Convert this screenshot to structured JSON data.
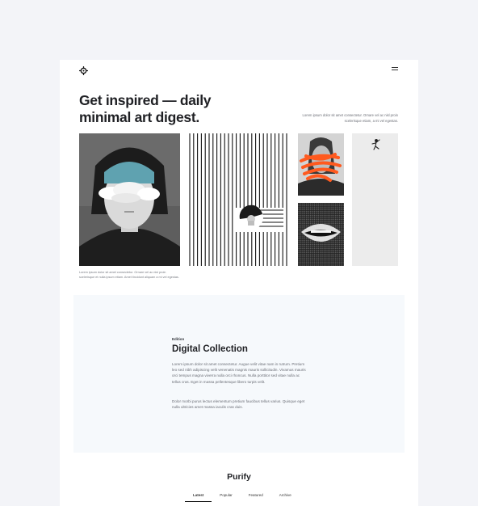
{
  "header": {
    "logo_icon": "crosshair-logo-icon",
    "menu_icon": "hamburger-menu-icon"
  },
  "hero": {
    "headline_line1": "Get inspired — daily",
    "headline_line2": "minimal art digest.",
    "intro_text": "Lorem ipsum dolor sit amet consectetur. Ornare vel ac nisl proin scelerisque etiam, a mi vel egestas.",
    "caption": "Lorem ipsum dolor sit amet consectetur. Ornare vel ac nisl proin scelerisque et nulla ipsum etiam. Amet tincidunt aliquam a mi vel egestas."
  },
  "gallery": {
    "items": [
      {
        "name": "woman-clouds-collage"
      },
      {
        "name": "line-art-dancer"
      },
      {
        "name": "orange-scribble-portrait"
      },
      {
        "name": "halftone-lips"
      },
      {
        "name": "tiny-dancer-figure"
      }
    ]
  },
  "edition": {
    "eyebrow": "Edition",
    "title": "Digital Collection",
    "paragraph1": "Lorem ipsum dolor sit amet consectetur. Augue velit vitae nam in rutrum. Pretium leo sed nibh adipiscing velit venenatis magnis mauris sollicitudin. Vivamus mauris orci tempus magna viverra nulla orci rhoncus. Nulla porttitor sed vitae nulla ac tellus cras. Eget in massa pellentesque libero turpis velit.",
    "paragraph2": "Dolor morbi purus lectus elementum pretium faucibus tellus varius. Quisque eget nulla ultricies amet massa iaculis cras duis."
  },
  "footer": {
    "title": "Purify",
    "tabs": [
      {
        "label": "Latest",
        "active": true
      },
      {
        "label": "Popular",
        "active": false
      },
      {
        "label": "Featured",
        "active": false
      },
      {
        "label": "Archive",
        "active": false
      }
    ]
  },
  "colors": {
    "background": "#f3f4f8",
    "card": "#ffffff",
    "edition_bg": "#f6f9fc",
    "accent_orange": "#ff5a1f",
    "accent_teal": "#5fa2b0"
  }
}
